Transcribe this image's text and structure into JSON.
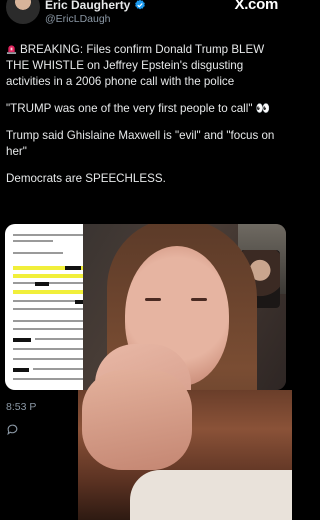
{
  "header": {
    "name": "Eric Daugherty",
    "handle": "@EricLDaugh",
    "brand": "X.com"
  },
  "tweet": {
    "line1": "BREAKING: Files confirm Donald Trump BLEW THE WHISTLE on Jeffrey Epstein's disgusting activities in a 2006 phone call with the police",
    "line2": "\"TRUMP was one of the very first people to call\" 👀",
    "line3": "Trump said Ghislaine Maxwell is \"evil\" and \"focus on her\"",
    "line4": "Democrats are SPEECHLESS."
  },
  "meta": {
    "time": "8:53 P"
  },
  "colors": {
    "background": "#000000",
    "text": "#e7e9ea",
    "muted": "#8b98a5",
    "verified": "#1d9bf0",
    "highlight": "#f1ef3a"
  },
  "icons": {
    "verified": "verified-badge-icon",
    "siren": "siren-icon",
    "reply": "reply-icon"
  }
}
